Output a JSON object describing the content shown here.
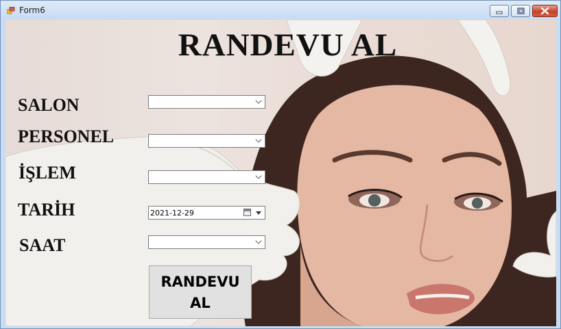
{
  "window": {
    "title": "Form6"
  },
  "form": {
    "heading": "RANDEVU AL",
    "fields": {
      "salon": {
        "label": "SALON",
        "value": ""
      },
      "personel": {
        "label": "PERSONEL",
        "value": ""
      },
      "islem": {
        "label": "İŞLEM",
        "value": ""
      },
      "tarih": {
        "label": "TARİH",
        "value": "2021-12-29"
      },
      "saat": {
        "label": "SAAT",
        "value": ""
      }
    },
    "submit": {
      "line1": "RANDEVU",
      "line2": "AL"
    }
  },
  "icons": [
    "form-app-icon",
    "minimize-icon",
    "maximize-icon",
    "close-icon",
    "chevron-down-icon",
    "calendar-icon"
  ],
  "colors": {
    "titlebar": "#c7dbf2",
    "close_button": "#c7412a",
    "button_face": "#e1e1e1"
  }
}
